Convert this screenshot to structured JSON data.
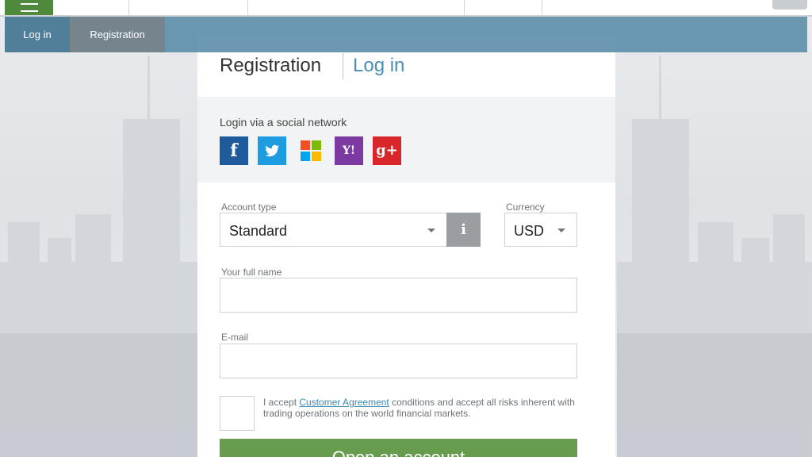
{
  "tabs": {
    "login": "Log in",
    "registration": "Registration"
  },
  "card": {
    "title": "Registration",
    "login_link": "Log in"
  },
  "social": {
    "label": "Login via a social network",
    "networks": [
      "facebook-icon",
      "twitter-icon",
      "windows-live-icon",
      "yahoo-icon",
      "google-plus-icon"
    ],
    "facebook_glyph": "f",
    "yahoo_glyph": "Y!",
    "google_glyph": "g+"
  },
  "form": {
    "account_type_label": "Account type",
    "account_type_value": "Standard",
    "info_glyph": "i",
    "currency_label": "Currency",
    "currency_value": "USD",
    "full_name_label": "Your full name",
    "full_name_value": "",
    "email_label": "E-mail",
    "email_value": "",
    "accept_prefix": "I accept",
    "accept_link": "Customer Agreement",
    "accept_suffix": "conditions and accept all risks inherent with trading operations on the world financial markets.",
    "submit_label": "Open an account"
  },
  "colors": {
    "tabbar": "#608faa",
    "menu_button": "#4f8a3c",
    "link": "#4a8fb5",
    "submit": "#679b4d",
    "facebook": "#1f5b9c",
    "twitter": "#1d9ce2",
    "yahoo": "#7c3aa0",
    "google_plus": "#d8262b"
  }
}
